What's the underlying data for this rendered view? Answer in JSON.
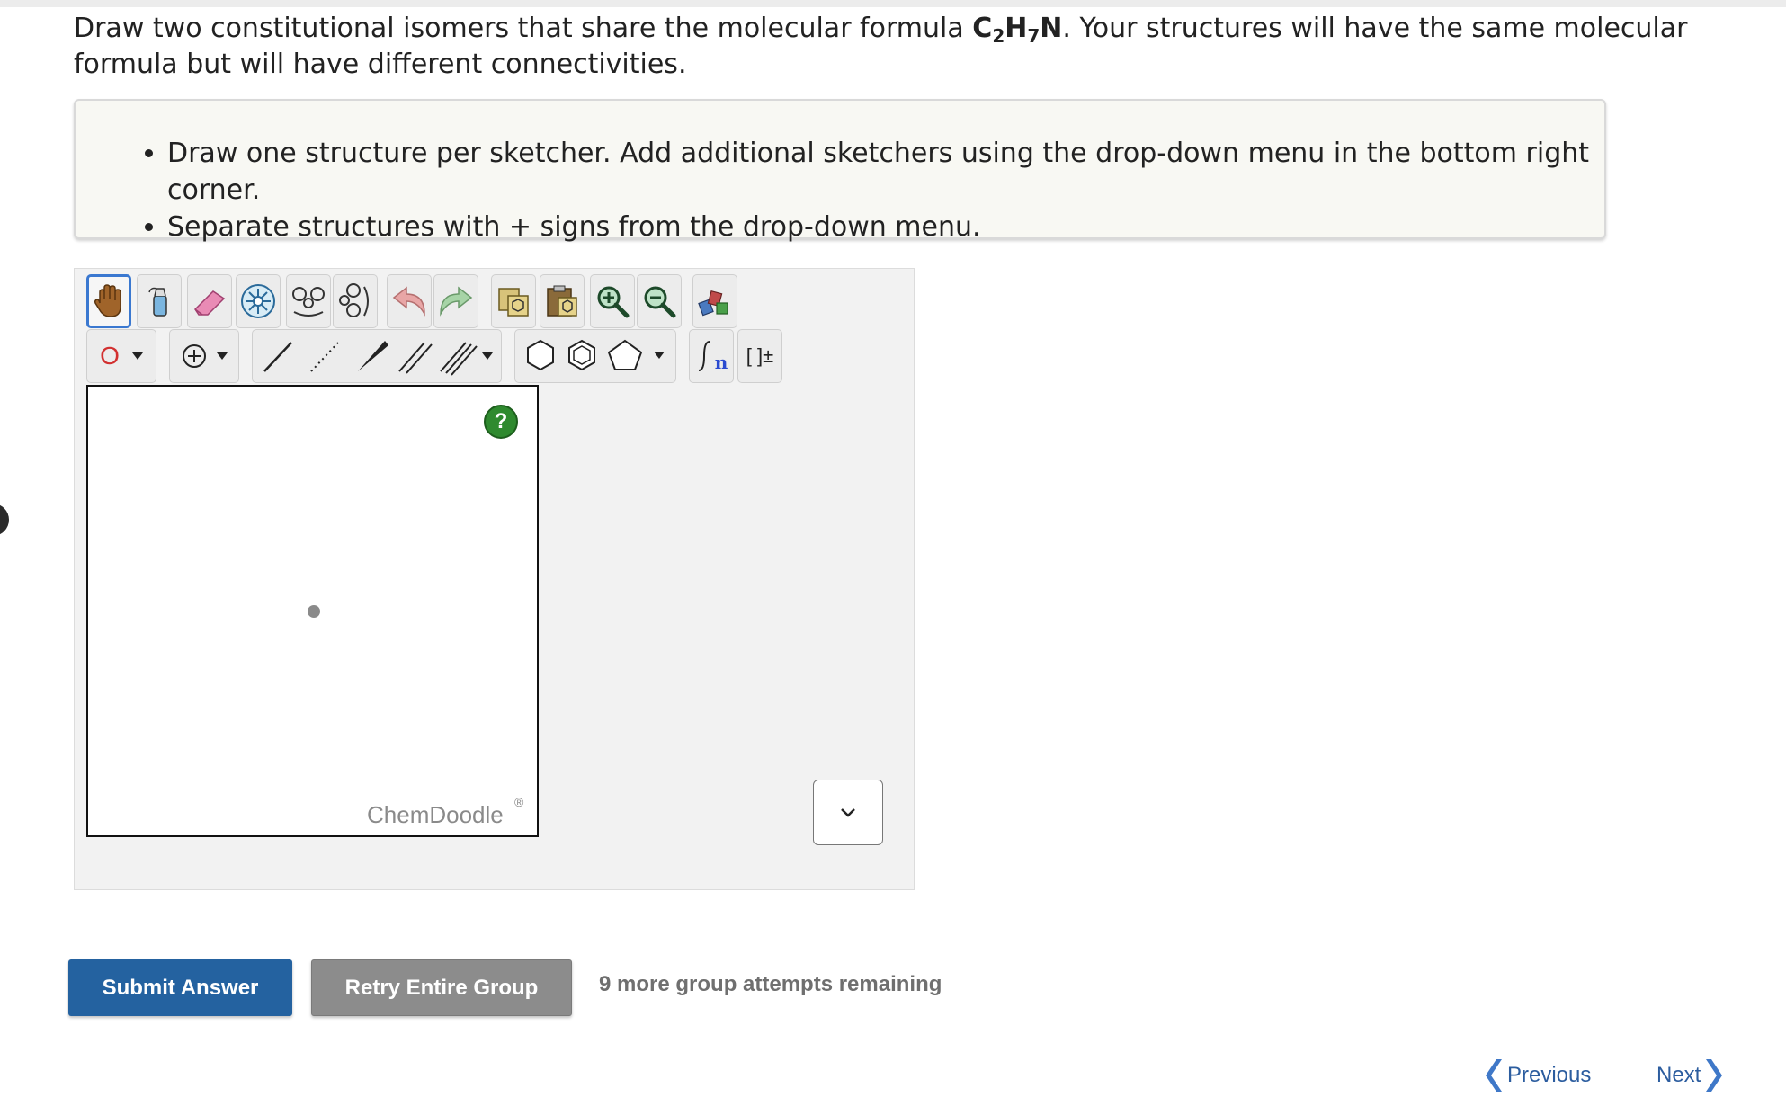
{
  "question": {
    "prefix": "Draw two constitutional isomers that share the molecular formula ",
    "formula": {
      "c": "C",
      "c_sub": "2",
      "h": "H",
      "h_sub": "7",
      "n": "N"
    },
    "suffix": ". Your structures will have the same molecular formula but will have different connectivities."
  },
  "instructions": [
    "Draw one structure per sketcher. Add additional sketchers using the drop-down menu in the bottom right corner.",
    "Separate structures with + signs from the drop-down menu."
  ],
  "toolbar": {
    "row1": [
      "hand-tool-icon",
      "lasso-tool-icon",
      "eraser-icon",
      "clear-icon",
      "flip-horizontal-icon",
      "flip-vertical-icon",
      "undo-icon",
      "redo-icon",
      "copy-icon",
      "paste-icon",
      "zoom-in-icon",
      "zoom-out-icon",
      "clean-icon"
    ],
    "atom_label": "O",
    "sgroup_label": "n",
    "bracket_label": "[ ]±"
  },
  "canvas": {
    "help_label": "?",
    "watermark": "ChemDoodle",
    "watermark_mark": "®"
  },
  "actions": {
    "submit_label": "Submit Answer",
    "retry_label": "Retry Entire Group",
    "attempts_text": "9 more group attempts remaining"
  },
  "navigation": {
    "previous_label": "Previous",
    "next_label": "Next"
  },
  "colors": {
    "primary": "#2462a0",
    "secondary": "#8c8c8c",
    "selected_tool": "#3a78d0",
    "help_green": "#2f8a2f",
    "nav_link": "#2c5d9f"
  }
}
